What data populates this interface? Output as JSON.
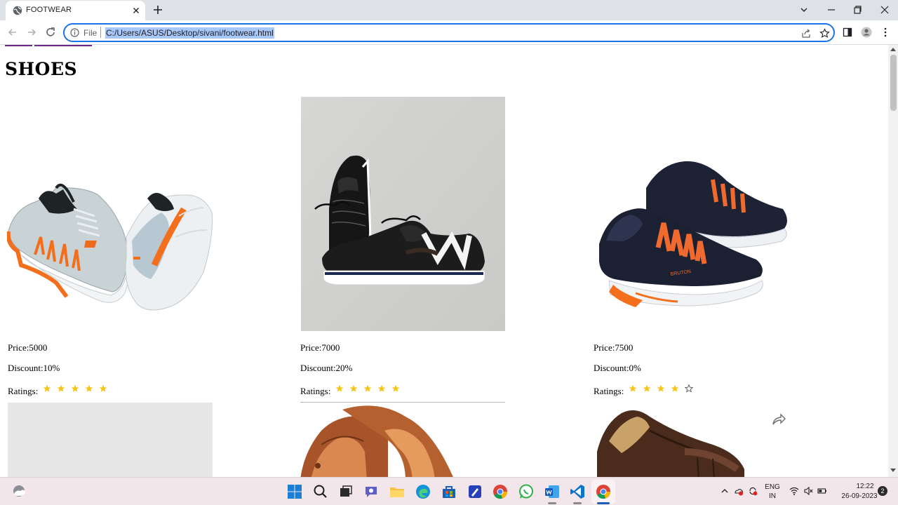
{
  "browser": {
    "tab_title": "FOOTWEAR",
    "url_scheme": "File",
    "url": "C:/Users/ASUS/Desktop/sivani/footwear.html"
  },
  "page": {
    "heading": "SHOES",
    "products": [
      {
        "price": "Price:5000",
        "discount": "Discount:10%",
        "ratings_label": "Ratings:",
        "rating": 5
      },
      {
        "price": "Price:7000",
        "discount": "Discount:20%",
        "ratings_label": "Ratings:",
        "rating": 5
      },
      {
        "price": "Price:7500",
        "discount": "Discount:0%",
        "ratings_label": "Ratings:",
        "rating": 4
      }
    ]
  },
  "taskbar": {
    "apps": [
      "start",
      "search",
      "task-view",
      "teams-chat",
      "file-explorer",
      "edge",
      "store",
      "word-pad",
      "chrome",
      "whatsapp",
      "word",
      "vscode",
      "chrome-active"
    ],
    "lang_top": "ENG",
    "lang_bottom": "IN",
    "time": "12:22",
    "date": "26-09-2023",
    "notifications": "2"
  },
  "colors": {
    "accent": "#1a73e8",
    "star": "#f5c518",
    "url_highlight": "#a8c7fa"
  }
}
